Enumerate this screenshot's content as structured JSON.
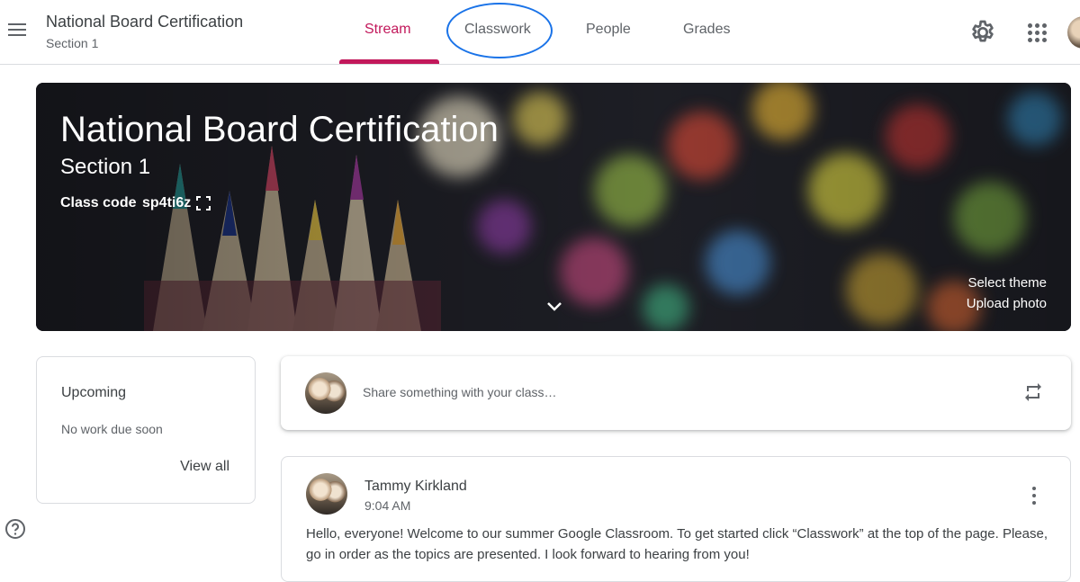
{
  "header": {
    "class_name": "National Board Certification",
    "section": "Section 1"
  },
  "tabs": [
    {
      "label": "Stream",
      "active": true
    },
    {
      "label": "Classwork",
      "active": false
    },
    {
      "label": "People",
      "active": false
    },
    {
      "label": "Grades",
      "active": false
    }
  ],
  "icons": {
    "menu": "hamburger-menu-icon",
    "settings": "gear-icon",
    "apps": "apps-grid-icon",
    "fullscreen": "fullscreen-icon",
    "expand": "chevron-down-icon",
    "repost": "repost-icon",
    "more": "more-vert-icon",
    "help": "help-icon"
  },
  "colors": {
    "accent": "#c2185b",
    "annotation": "#1a73e8"
  },
  "banner": {
    "title": "National Board Certification",
    "section": "Section 1",
    "class_code_label": "Class code",
    "class_code": "sp4ti6z",
    "select_theme": "Select theme",
    "upload_photo": "Upload photo"
  },
  "upcoming": {
    "title": "Upcoming",
    "empty_text": "No work due soon",
    "view_all": "View all"
  },
  "share": {
    "placeholder": "Share something with your class…"
  },
  "post": {
    "author": "Tammy Kirkland",
    "time": "9:04 AM",
    "body": "Hello, everyone! Welcome to our summer Google Classroom. To get started click “Classwork” at the top of the page. Please, go in order as the topics are presented. I look forward to hearing from you!"
  }
}
